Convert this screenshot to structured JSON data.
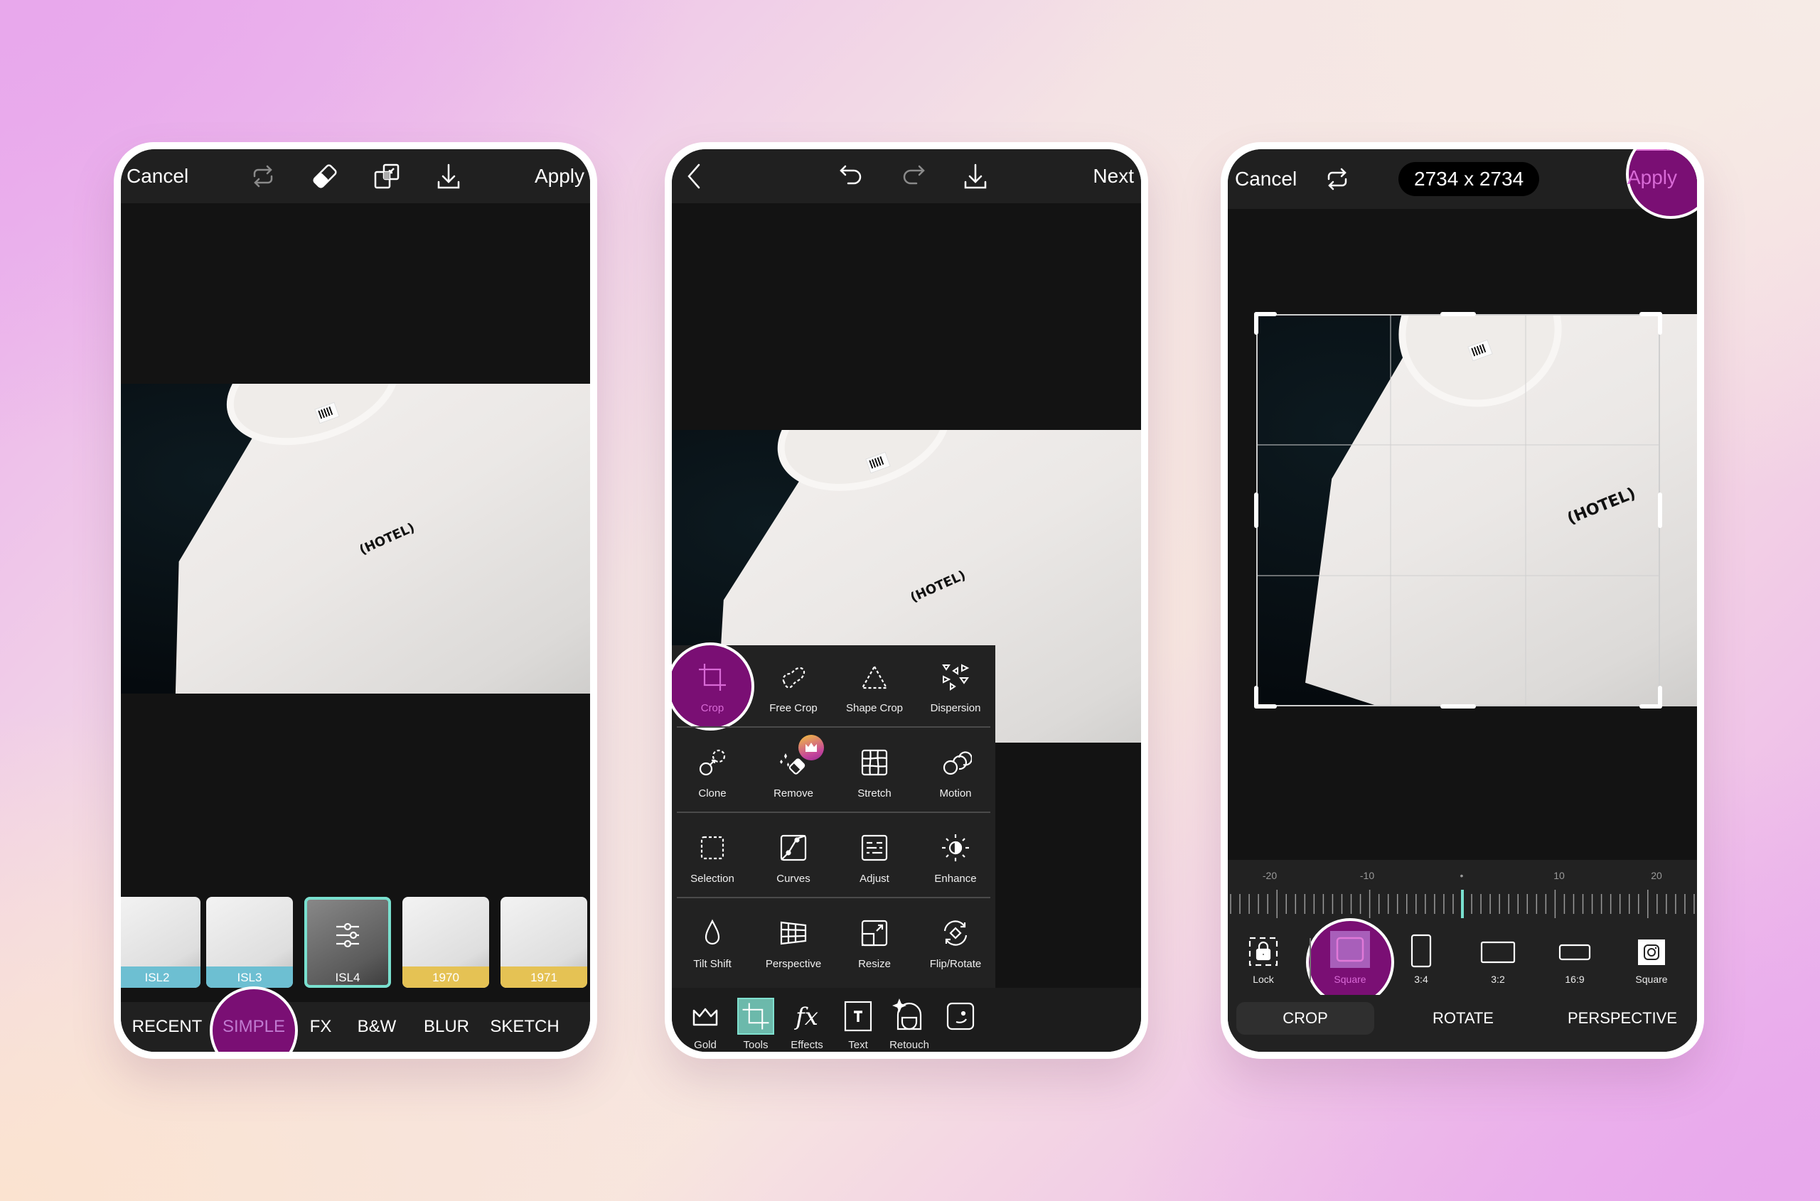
{
  "colors": {
    "accent_purple": "#7a0f74",
    "accent_pink_text": "#d86ad6",
    "accent_teal": "#79e0cf",
    "panel_dark": "#202020",
    "canvas_dark": "#131313"
  },
  "phone1": {
    "topbar": {
      "cancel": "Cancel",
      "apply": "Apply",
      "icons": [
        "swap-icon",
        "eraser-icon",
        "blend-mode-icon",
        "download-icon"
      ]
    },
    "photo": {
      "shirt_print": "(HOTEL)"
    },
    "filters": [
      {
        "label": "ISL2",
        "band": "blue"
      },
      {
        "label": "ISL3",
        "band": "blue"
      },
      {
        "label": "ISL4",
        "band": "none",
        "selected": true,
        "icon": "sliders-icon"
      },
      {
        "label": "1970",
        "band": "yellow"
      },
      {
        "label": "1971",
        "band": "yellow"
      }
    ],
    "categories": [
      {
        "label": "RECENT"
      },
      {
        "label": "SIMPLE",
        "active": true
      },
      {
        "label": "FX"
      },
      {
        "label": "B&W"
      },
      {
        "label": "BLUR"
      },
      {
        "label": "SKETCH"
      }
    ]
  },
  "phone2": {
    "topbar": {
      "back_icon": "chevron-left-icon",
      "undo_icon": "undo-icon",
      "redo_icon": "redo-icon",
      "download_icon": "download-icon",
      "next": "Next"
    },
    "photo": {
      "shirt_print": "(HOTEL)"
    },
    "tools": [
      [
        {
          "label": "Crop",
          "icon": "crop-icon",
          "active": true
        },
        {
          "label": "Free Crop",
          "icon": "free-crop-icon"
        },
        {
          "label": "Shape Crop",
          "icon": "shape-crop-icon"
        },
        {
          "label": "Dispersion",
          "icon": "dispersion-icon"
        }
      ],
      [
        {
          "label": "Clone",
          "icon": "clone-icon"
        },
        {
          "label": "Remove",
          "icon": "remove-icon",
          "premium": true
        },
        {
          "label": "Stretch",
          "icon": "stretch-icon"
        },
        {
          "label": "Motion",
          "icon": "motion-icon"
        }
      ],
      [
        {
          "label": "Selection",
          "icon": "selection-icon"
        },
        {
          "label": "Curves",
          "icon": "curves-icon"
        },
        {
          "label": "Adjust",
          "icon": "adjust-icon"
        },
        {
          "label": "Enhance",
          "icon": "enhance-icon"
        }
      ],
      [
        {
          "label": "Tilt Shift",
          "icon": "tilt-shift-icon"
        },
        {
          "label": "Perspective",
          "icon": "perspective-icon"
        },
        {
          "label": "Resize",
          "icon": "resize-icon"
        },
        {
          "label": "Flip/Rotate",
          "icon": "flip-rotate-icon"
        }
      ]
    ],
    "bottom_nav": [
      {
        "label": "Gold",
        "icon": "crown-icon"
      },
      {
        "label": "Tools",
        "icon": "crop-icon",
        "active": true
      },
      {
        "label": "Effects",
        "icon": "fx-icon"
      },
      {
        "label": "Text",
        "icon": "text-icon"
      },
      {
        "label": "Retouch",
        "icon": "retouch-icon"
      },
      {
        "label": "",
        "icon": "sticker-icon"
      }
    ]
  },
  "phone3": {
    "topbar": {
      "cancel": "Cancel",
      "swap_icon": "swap-icon",
      "dimensions": "2734 x 2734",
      "apply": "Apply"
    },
    "photo": {
      "shirt_print": "(HOTEL)"
    },
    "ruler": {
      "labels": [
        "-20",
        "-10",
        "•",
        "10",
        "20"
      ],
      "value": 0,
      "min": -25,
      "max": 25
    },
    "ratios": [
      {
        "label": "Lock",
        "icon": "lock-icon"
      },
      {
        "label": "Square",
        "icon": "square-icon",
        "active": true
      },
      {
        "label": "3:4",
        "icon": "ratio-3-4-icon"
      },
      {
        "label": "3:2",
        "icon": "ratio-3-2-icon"
      },
      {
        "label": "16:9",
        "icon": "ratio-16-9-icon"
      },
      {
        "label": "Square",
        "icon": "instagram-icon"
      }
    ],
    "modes": [
      {
        "label": "CROP",
        "active": true
      },
      {
        "label": "ROTATE"
      },
      {
        "label": "PERSPECTIVE"
      }
    ]
  }
}
